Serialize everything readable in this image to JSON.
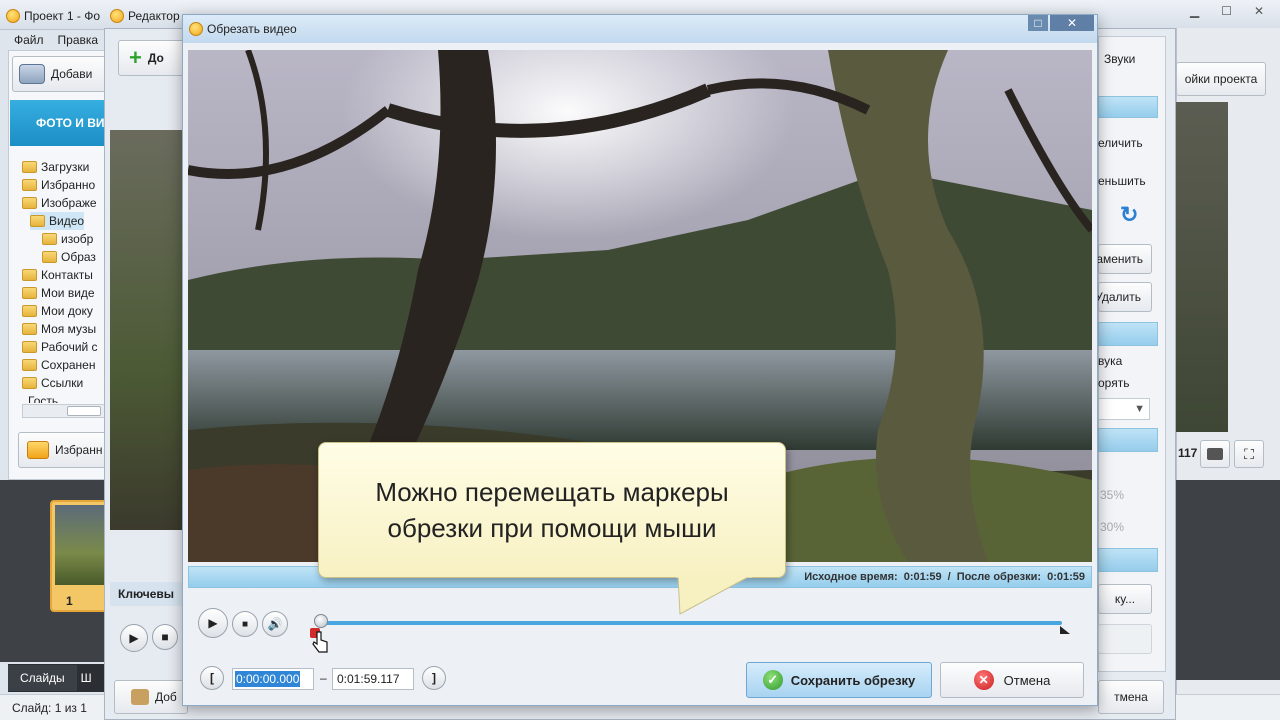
{
  "bg_window": {
    "title_tab1": "Проект 1 - Фо",
    "title_tab2": "Редактор",
    "menu": [
      "Файл",
      "Правка"
    ],
    "add_button": "Добави",
    "add_button2": "До",
    "sounds_tab": "Звуки",
    "project_settings": "ойки проекта",
    "photo_tab": "ФОТО И ВИ",
    "tree": [
      "Загрузки",
      "Избранно",
      "Изображе",
      "Видео",
      "изобр",
      "Образ",
      "Контакты",
      "Мои виде",
      "Мои доку",
      "Моя музы",
      "Рабочий с",
      "Сохранен",
      "Ссылки",
      "Гость"
    ],
    "favorites_btn": "Избранн",
    "right_items": [
      "еличить",
      "еньшить",
      "аменить",
      "Удалить",
      "вука",
      "орять"
    ],
    "pct1": "35%",
    "pct2": "30%",
    "time_short": "117",
    "keyframes": "Ключевы",
    "slide_num": "1",
    "slides_tab": "Слайды",
    "slides_tab2": "Ш",
    "add_bottom": "Доб",
    "cancel_bottom": "тмена",
    "dots": "ку...",
    "status": "Слайд: 1 из 1"
  },
  "dialog": {
    "title": "Обрезать видео",
    "tooltip": "Можно перемещать маркеры обрезки при помощи мыши",
    "orig_time_label": "Исходное время:",
    "orig_time": "0:01:59",
    "after_label": "После обрезки:",
    "after_time": "0:01:59",
    "start_time": "0:00:00.000",
    "separator": "–",
    "end_time": "0:01:59.117",
    "bracket_left": "[",
    "bracket_right": "]",
    "save_btn": "Сохранить обрезку",
    "cancel_btn": "Отмена",
    "progress": 0.0
  }
}
